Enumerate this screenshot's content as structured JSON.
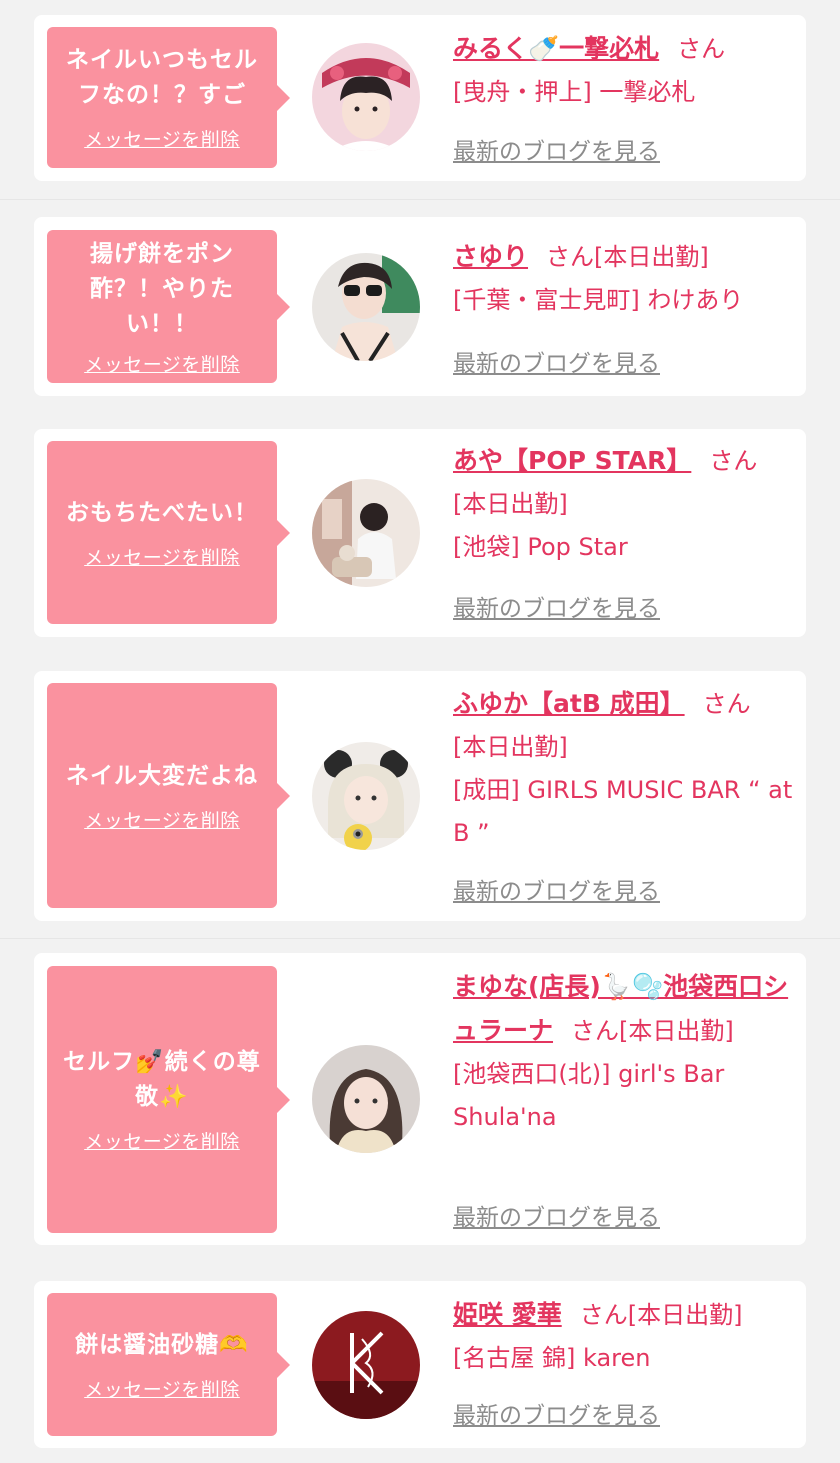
{
  "colors": {
    "accent": "#e3355f",
    "bubble": "#fa929f",
    "link_gray": "#8c8c8c",
    "bg": "#f2f2f2"
  },
  "delete_label": "メッセージを削除",
  "blog_label": "最新のブログを見る",
  "honorific": "さん",
  "items": [
    {
      "message_lines": [
        "ネイルいつもセル",
        "フなの！？すご"
      ],
      "name": "みるく🍼一撃必札",
      "status": "",
      "store": "[曳舟・押上] 一撃必札",
      "avatar_icon": "avatar-photo"
    },
    {
      "message_lines": [
        "揚げ餅をポン",
        "酢？！やりた",
        "い！！"
      ],
      "name": "さゆり",
      "status": "[本日出勤]",
      "store": "[千葉・富士見町] わけあり",
      "avatar_icon": "avatar-photo"
    },
    {
      "message_lines": [
        "おもちたべたい！"
      ],
      "name": "あや【POP STAR】",
      "status": "[本日出勤]",
      "store": "[池袋] Pop Star",
      "avatar_icon": "avatar-photo"
    },
    {
      "message_lines": [
        "ネイル大変だよね"
      ],
      "name": "ふゆか【atB 成田】",
      "status": "[本日出勤]",
      "store": "[成田] GIRLS MUSIC BAR “ at B ”",
      "avatar_icon": "avatar-photo"
    },
    {
      "message_lines": [
        "セルフ💅続くの尊",
        "敬✨"
      ],
      "name": "まゆな(店長)🪿🫧池袋西口シュラーナ",
      "status": "[本日出勤]",
      "store": "[池袋西口(北)] girl's Bar Shula'na",
      "avatar_icon": "avatar-photo"
    },
    {
      "message_lines": [
        "餅は醤油砂糖🫶"
      ],
      "name": "姫咲 愛華",
      "status": "[本日出勤]",
      "store": "[名古屋 錦] karen",
      "avatar_icon": "karen-logo"
    }
  ]
}
